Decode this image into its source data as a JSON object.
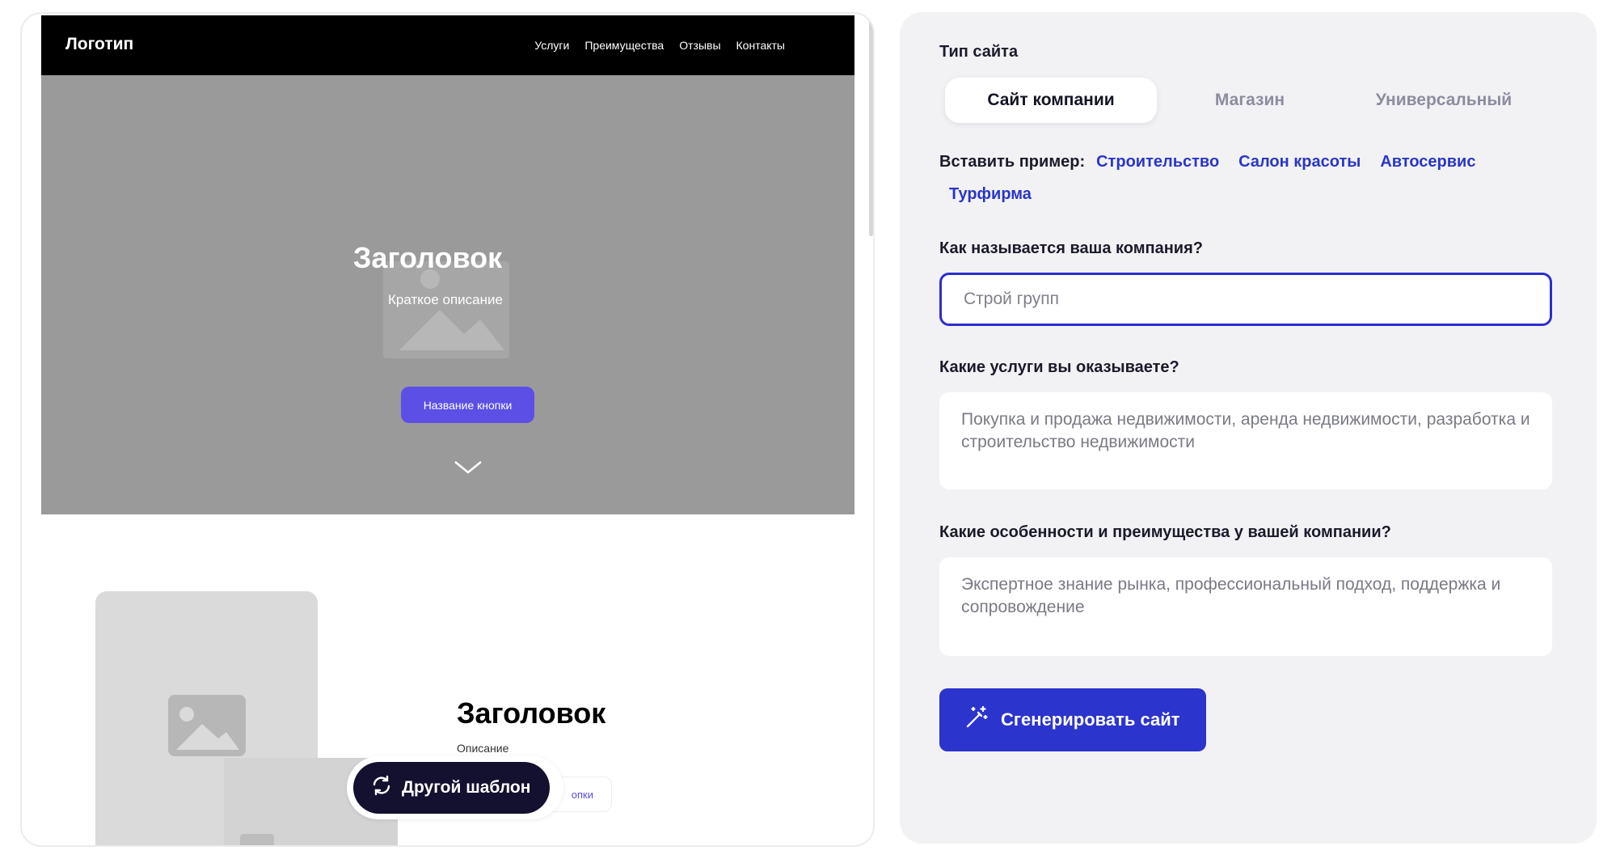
{
  "preview": {
    "logo": "Логотип",
    "menu": [
      "Услуги",
      "Преимущества",
      "Отзывы",
      "Контакты"
    ],
    "hero": {
      "title": "Заголовок",
      "description": "Краткое описание",
      "button_label": "Название кнопки"
    },
    "section": {
      "title": "Заголовок",
      "description": "Описание",
      "button_partial_label": "опки"
    },
    "other_template_label": "Другой шаблон"
  },
  "form": {
    "site_type_label": "Тип сайта",
    "site_types": [
      {
        "label": "Сайт компании",
        "active": true
      },
      {
        "label": "Магазин",
        "active": false
      },
      {
        "label": "Универсальный",
        "active": false
      }
    ],
    "examples_label": "Вставить пример:",
    "examples": [
      "Строительство",
      "Салон красоты",
      "Автосервис",
      "Турфирма"
    ],
    "company_name_label": "Как называется ваша компания?",
    "company_name_placeholder": "Строй групп",
    "services_label": "Какие услуги вы оказываете?",
    "services_placeholder": "Покупка и продажа недвижимости, аренда недвижимости, разработка и строительство недвижимости",
    "features_label": "Какие особенности и преимущества у вашей компании?",
    "features_placeholder": "Экспертное знание рынка, профессиональный подход, поддержка и сопровождение",
    "generate_label": "Сгенерировать сайт"
  },
  "colors": {
    "accent": "#2b34cc",
    "link": "#2a36c8",
    "hero_button": "#5b4fe6",
    "dark_button": "#14102f"
  }
}
